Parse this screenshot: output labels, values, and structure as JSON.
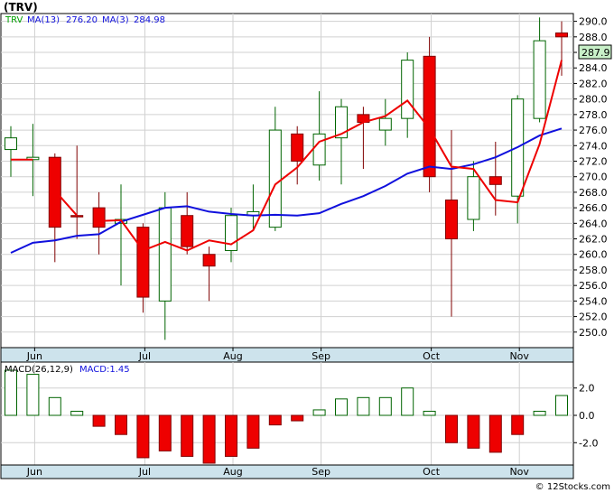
{
  "chart_data": {
    "type": "candlestick",
    "title": "(TRV)",
    "legend": {
      "ticker": "TRV",
      "ma13_label": "MA(13)",
      "ma13_value": "276.20",
      "ma3_label": "MA(3)",
      "ma3_value": "284.98"
    },
    "last_price_label": "287.9",
    "ylim": [
      248,
      291
    ],
    "yticks": [
      250,
      252,
      254,
      256,
      258,
      260,
      262,
      264,
      266,
      268,
      270,
      272,
      274,
      276,
      278,
      280,
      282,
      284,
      286,
      288,
      290
    ],
    "x_months": [
      {
        "label": "Jun",
        "index": 1
      },
      {
        "label": "Jul",
        "index": 6
      },
      {
        "label": "Aug",
        "index": 10
      },
      {
        "label": "Sep",
        "index": 14
      },
      {
        "label": "Oct",
        "index": 19
      },
      {
        "label": "Nov",
        "index": 23
      }
    ],
    "candles": [
      {
        "o": 273.5,
        "h": 276.5,
        "l": 270.0,
        "c": 275.0,
        "up": true
      },
      {
        "o": 272.2,
        "h": 276.8,
        "l": 267.5,
        "c": 272.5,
        "up": true
      },
      {
        "o": 272.5,
        "h": 273.0,
        "l": 259.0,
        "c": 263.5,
        "up": false
      },
      {
        "o": 265.0,
        "h": 274.0,
        "l": 262.0,
        "c": 265.0,
        "up": false
      },
      {
        "o": 266.0,
        "h": 268.0,
        "l": 260.0,
        "c": 263.5,
        "up": false
      },
      {
        "o": 264.0,
        "h": 269.0,
        "l": 256.0,
        "c": 264.5,
        "up": true
      },
      {
        "o": 263.5,
        "h": 264.0,
        "l": 252.5,
        "c": 254.5,
        "up": false
      },
      {
        "o": 254.0,
        "h": 268.0,
        "l": 249.0,
        "c": 266.0,
        "up": true
      },
      {
        "o": 265.0,
        "h": 268.0,
        "l": 260.0,
        "c": 261.0,
        "up": false
      },
      {
        "o": 260.0,
        "h": 261.0,
        "l": 254.0,
        "c": 258.5,
        "up": false
      },
      {
        "o": 260.5,
        "h": 266.0,
        "l": 259.0,
        "c": 265.0,
        "up": true
      },
      {
        "o": 265.0,
        "h": 269.0,
        "l": 263.0,
        "c": 265.5,
        "up": true
      },
      {
        "o": 263.5,
        "h": 279.0,
        "l": 263.0,
        "c": 276.0,
        "up": true
      },
      {
        "o": 275.5,
        "h": 276.5,
        "l": 269.0,
        "c": 272.0,
        "up": false
      },
      {
        "o": 271.5,
        "h": 281.0,
        "l": 269.5,
        "c": 275.5,
        "up": true
      },
      {
        "o": 275.0,
        "h": 280.0,
        "l": 269.0,
        "c": 279.0,
        "up": true
      },
      {
        "o": 278.0,
        "h": 279.0,
        "l": 271.0,
        "c": 277.0,
        "up": false
      },
      {
        "o": 276.0,
        "h": 280.0,
        "l": 274.0,
        "c": 277.5,
        "up": true
      },
      {
        "o": 277.5,
        "h": 286.0,
        "l": 275.0,
        "c": 285.0,
        "up": true
      },
      {
        "o": 285.5,
        "h": 288.0,
        "l": 268.0,
        "c": 270.0,
        "up": false
      },
      {
        "o": 267.0,
        "h": 276.0,
        "l": 252.0,
        "c": 262.0,
        "up": false
      },
      {
        "o": 264.5,
        "h": 272.0,
        "l": 263.0,
        "c": 270.0,
        "up": true
      },
      {
        "o": 270.0,
        "h": 274.5,
        "l": 265.0,
        "c": 269.0,
        "up": false
      },
      {
        "o": 267.5,
        "h": 280.5,
        "l": 264.0,
        "c": 280.0,
        "up": true
      },
      {
        "o": 277.5,
        "h": 290.5,
        "l": 277.0,
        "c": 287.5,
        "up": true
      },
      {
        "o": 288.5,
        "h": 290.0,
        "l": 283.0,
        "c": 288.0,
        "up": false
      }
    ],
    "ma13": [
      [
        0,
        260.2
      ],
      [
        1,
        261.5
      ],
      [
        2,
        261.8
      ],
      [
        3,
        262.4
      ],
      [
        4,
        262.6
      ],
      [
        5,
        264.2
      ],
      [
        6,
        265.1
      ],
      [
        7,
        266.0
      ],
      [
        8,
        266.2
      ],
      [
        9,
        265.5
      ],
      [
        10,
        265.2
      ],
      [
        11,
        265.0
      ],
      [
        12,
        265.1
      ],
      [
        13,
        265.0
      ],
      [
        14,
        265.3
      ],
      [
        15,
        266.5
      ],
      [
        16,
        267.5
      ],
      [
        17,
        268.8
      ],
      [
        18,
        270.4
      ],
      [
        19,
        271.3
      ],
      [
        20,
        271.0
      ],
      [
        21,
        271.6
      ],
      [
        22,
        272.5
      ],
      [
        23,
        273.8
      ],
      [
        24,
        275.3
      ],
      [
        25,
        276.2
      ]
    ],
    "ma3_segments": [
      [
        [
          0,
          272.2
        ],
        [
          1,
          272.2
        ]
      ],
      [
        [
          2,
          268.2
        ],
        [
          3,
          265.0
        ]
      ],
      [
        [
          4,
          264.3
        ],
        [
          5,
          264.4
        ],
        [
          6,
          260.5
        ],
        [
          7,
          261.6
        ],
        [
          8,
          260.5
        ],
        [
          9,
          261.8
        ],
        [
          10,
          261.3
        ],
        [
          11,
          263.1
        ],
        [
          12,
          269.0
        ],
        [
          13,
          271.2
        ],
        [
          14,
          274.5
        ],
        [
          15,
          275.5
        ],
        [
          16,
          277.0
        ],
        [
          17,
          277.8
        ],
        [
          18,
          279.8
        ],
        [
          19,
          276.2
        ],
        [
          20,
          271.3
        ],
        [
          21,
          271.0
        ],
        [
          22,
          267.0
        ],
        [
          23,
          266.7
        ],
        [
          24,
          274.2
        ],
        [
          25,
          285.0
        ]
      ]
    ],
    "macd": {
      "label": "MACD(26,12,9)",
      "value_label": "MACD:1.45",
      "ylim": [
        -3.5,
        3.5
      ],
      "yticks": [
        -2.0,
        0.0,
        2.0
      ],
      "ytick_labels": [
        "-2.0",
        "0.0",
        "2.0"
      ],
      "histogram": [
        3.3,
        3.0,
        1.3,
        0.3,
        -0.8,
        -1.4,
        -3.1,
        -2.6,
        -3.0,
        -3.5,
        -3.0,
        -2.4,
        -0.7,
        -0.4,
        0.4,
        1.2,
        1.3,
        1.3,
        2.0,
        0.3,
        -2.0,
        -2.4,
        -2.7,
        -1.4,
        0.3,
        1.45
      ]
    }
  },
  "footer": "© 12Stocks.com"
}
